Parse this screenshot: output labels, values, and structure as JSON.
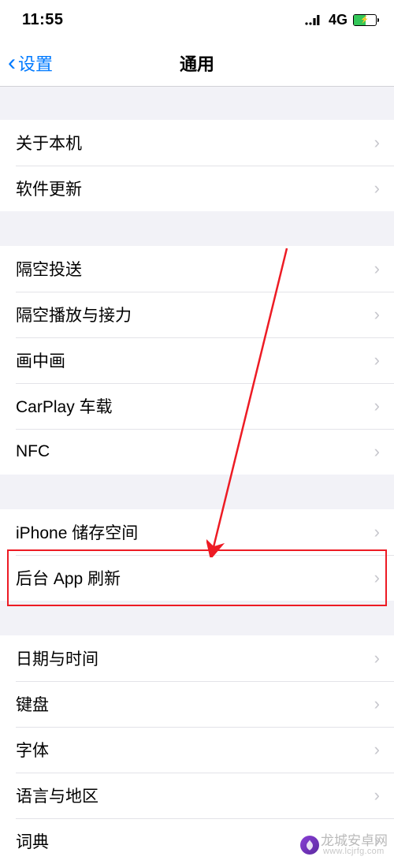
{
  "status": {
    "time": "11:55",
    "network": "4G"
  },
  "nav": {
    "back": "设置",
    "title": "通用"
  },
  "groups": [
    {
      "items": [
        "关于本机",
        "软件更新"
      ]
    },
    {
      "items": [
        "隔空投送",
        "隔空播放与接力",
        "画中画",
        "CarPlay 车载",
        "NFC"
      ]
    },
    {
      "items": [
        "iPhone 储存空间",
        "后台 App 刷新"
      ],
      "highlight_index": 1
    },
    {
      "items": [
        "日期与时间",
        "键盘",
        "字体",
        "语言与地区",
        "词典"
      ]
    }
  ],
  "watermark": {
    "name": "龙城安卓网",
    "url": "www.lcjrfg.com"
  }
}
